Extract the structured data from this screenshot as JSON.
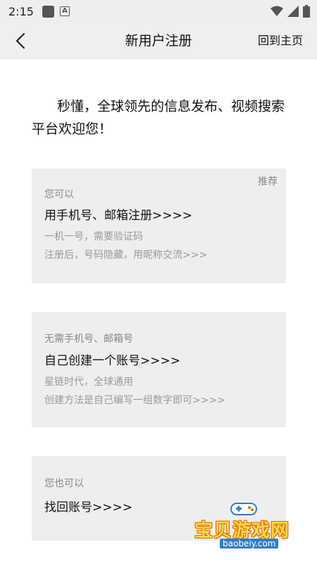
{
  "status": {
    "time": "2:15"
  },
  "header": {
    "title": "新用户注册",
    "home_label": "回到主页"
  },
  "intro": "秒懂，全球领先的信息发布、视频搜索平台欢迎您！",
  "cards": [
    {
      "tag": "推荐",
      "lead": "您可以",
      "main": "用手机号、邮箱注册>>>>",
      "subs": [
        "一机一号，需要验证码",
        "注册后，号码隐藏，用昵称交流>>>"
      ]
    },
    {
      "lead": "无需手机号、邮箱号",
      "main": "自己创建一个账号>>>>",
      "subs": [
        "星链时代，全球通用",
        "创建方法是自己编写一组数字即可>>>>"
      ]
    },
    {
      "lead": "您也可以",
      "main": "找回账号>>>>"
    }
  ],
  "watermark": {
    "text": "宝贝游戏网",
    "url": "baobeiy.com"
  }
}
